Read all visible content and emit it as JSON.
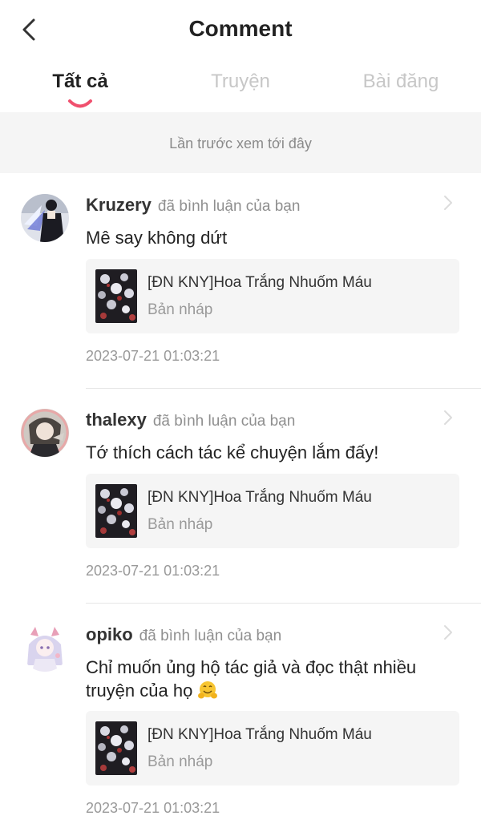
{
  "header": {
    "title": "Comment"
  },
  "tabs": [
    {
      "label": "Tất cả"
    },
    {
      "label": "Truyện"
    },
    {
      "label": "Bài đăng"
    }
  ],
  "last_seen": "Lần trước xem tới đây",
  "comments": [
    {
      "username": "Kruzery",
      "action": "đã bình luận của bạn",
      "text": "Mê say không dứt",
      "story_title": "[ĐN KNY]Hoa Trắng Nhuốm Máu",
      "story_status": "Bản nháp",
      "timestamp": "2023-07-21 01:03:21"
    },
    {
      "username": "thalexy",
      "action": "đã bình luận của bạn",
      "text": "Tớ thích cách tác kể chuyện lắm đấy!",
      "story_title": "[ĐN KNY]Hoa Trắng Nhuốm Máu",
      "story_status": "Bản nháp",
      "timestamp": "2023-07-21 01:03:21"
    },
    {
      "username": "opiko",
      "action": "đã bình luận của bạn",
      "text": "Chỉ muốn ủng hộ tác giả và đọc thật nhiều truyện của họ",
      "emoji": "hugging-face-emoji",
      "story_title": "[ĐN KNY]Hoa Trắng Nhuốm Máu",
      "story_status": "Bản nháp",
      "timestamp": "2023-07-21 01:03:21"
    }
  ],
  "colors": {
    "accent": "#f0506e",
    "panel": "#f5f5f5"
  }
}
